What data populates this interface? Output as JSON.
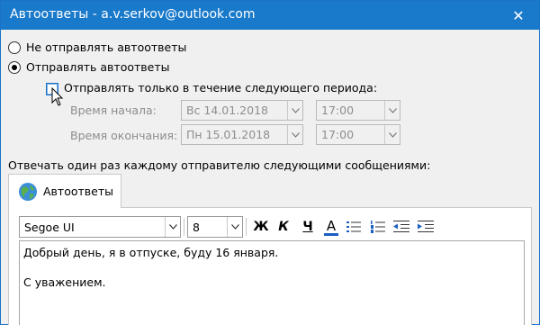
{
  "window": {
    "title": "Автоответы - a.v.serkov@outlook.com",
    "close_glyph": "✕"
  },
  "options": {
    "dont_send": "Не отправлять автоответы",
    "send": "Отправлять автоответы",
    "only_period": "Отправлять только в течение следующего периода:"
  },
  "period": {
    "start_label": "Время начала:",
    "end_label": "Время окончания:",
    "start_date": "Вс 14.01.2018",
    "start_time": "17:00",
    "end_date": "Пн 15.01.2018",
    "end_time": "17:00"
  },
  "reply_once_label": "Отвечать один раз каждому отправителю следующими сообщениями:",
  "tab": {
    "label": "Автоответы",
    "icon": "globe-icon"
  },
  "format": {
    "font": "Segoe UI",
    "size": "8",
    "bold": "Ж",
    "italic": "К",
    "underline": "Ч",
    "font_color": "A"
  },
  "message": {
    "line1": "Добрый день, я в отпуске, буду 16 января.",
    "line2": "С уважением."
  },
  "colors": {
    "titlebar": "#1979ca",
    "accent": "#1a6fc4"
  }
}
